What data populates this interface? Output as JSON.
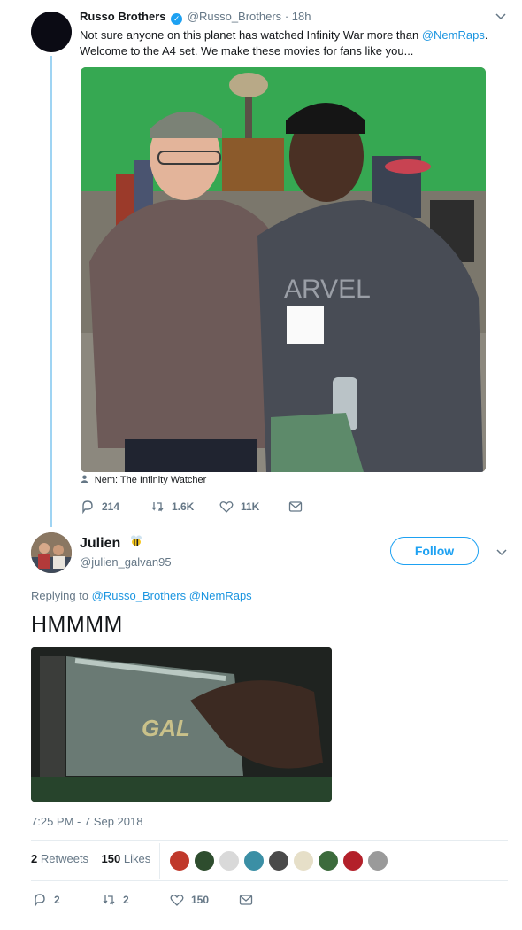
{
  "parent_tweet": {
    "name": "Russo Brothers",
    "handle": "@Russo_Brothers",
    "time_sep": "·",
    "time": "18h",
    "text_part1": "Not sure anyone on this planet has watched Infinity War more than ",
    "mention": "@NemRaps",
    "text_part2": ". Welcome to the A4 set. We make these movies for fans like you...",
    "tag": "Nem: The Infinity Watcher",
    "replies": "214",
    "retweets": "1.6K",
    "likes": "11K"
  },
  "reply_tweet": {
    "name": "Julien",
    "handle": "@julien_galvan95",
    "follow_label": "Follow",
    "replying_label": "Replying to",
    "replying_to": "@Russo_Brothers @NemRaps",
    "text": "HMMMM",
    "timestamp": "7:25 PM - 7 Sep 2018",
    "retweets_count": "2",
    "retweets_label": "Retweets",
    "likes_count": "150",
    "likes_label": "Likes",
    "replies": "2",
    "retweets": "2",
    "likes": "150"
  },
  "colors": {
    "link": "#1b95e0",
    "muted": "#657786",
    "thread": "#9fd4f3",
    "green_screen": "#35a853"
  }
}
